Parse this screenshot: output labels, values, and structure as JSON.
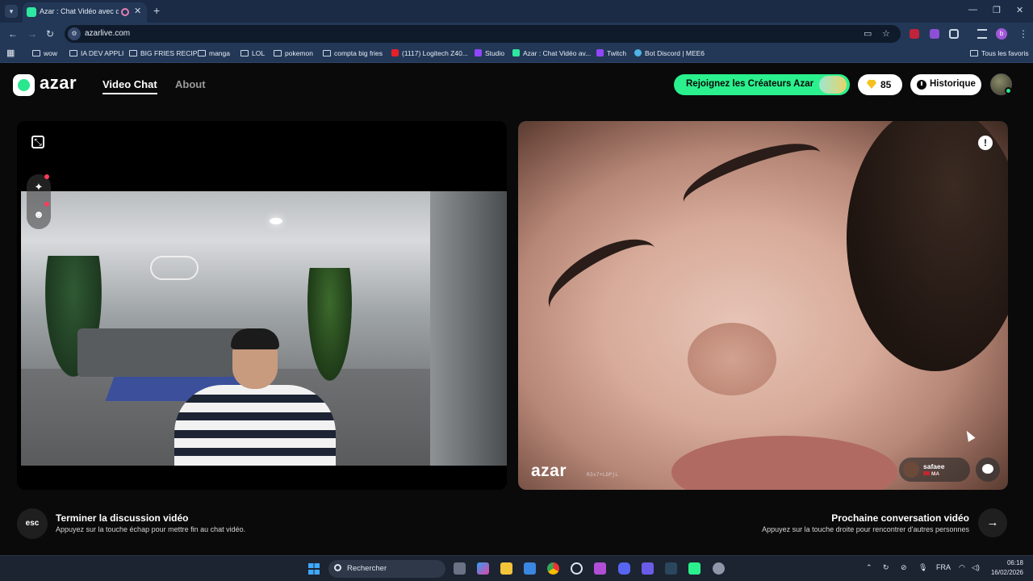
{
  "browser": {
    "tab_title": "Azar : Chat Vidéo avec de n",
    "url": "azarlive.com",
    "bookmarks": [
      {
        "label": "wow",
        "icon": "folder-icon"
      },
      {
        "label": "IA DEV APPLI",
        "icon": "folder-icon"
      },
      {
        "label": "BIG FRIES RECIP",
        "icon": "folder-icon"
      },
      {
        "label": "manga",
        "icon": "folder-icon"
      },
      {
        "label": "LOL",
        "icon": "folder-icon"
      },
      {
        "label": "pokemon",
        "icon": "folder-icon"
      },
      {
        "label": "compta big fries",
        "icon": "folder-icon"
      },
      {
        "label": "(1117) Logitech Z40...",
        "icon": "youtube-icon"
      },
      {
        "label": "Studio",
        "icon": "twitch-icon"
      },
      {
        "label": "Azar : Chat Vidéo av...",
        "icon": "azar-icon"
      },
      {
        "label": "Twitch",
        "icon": "twitch-icon"
      },
      {
        "label": "Bot Discord | MEE6",
        "icon": "mee6-icon"
      }
    ],
    "all_favorites": "Tous les favoris",
    "profile_initial": "b"
  },
  "app": {
    "logo_text": "azar",
    "nav": {
      "video_chat": "Video Chat",
      "about": "About"
    },
    "creators_button": "Rejoignez les Créateurs Azar",
    "gems_count": "85",
    "history_button": "Historique"
  },
  "peer": {
    "name": "safaee",
    "country": "MA",
    "watermark": "azar",
    "code": "R3x7+LDPjL"
  },
  "actions": {
    "esc_key": "esc",
    "end_title": "Terminer la discussion vidéo",
    "end_subtitle": "Appuyez sur la touche échap pour mettre fin au chat vidéo.",
    "next_title": "Prochaine conversation vidéo",
    "next_subtitle": "Appuyez sur la touche droite pour rencontrer d'autres personnes",
    "next_key": "→"
  },
  "taskbar": {
    "search_label": "Rechercher",
    "language": "FRA",
    "time": "06:18",
    "date": "16/02/2026"
  },
  "colors": {
    "brand_green": "#2af08d",
    "browser_chrome": "#233857",
    "app_background": "#0a0a0a"
  }
}
